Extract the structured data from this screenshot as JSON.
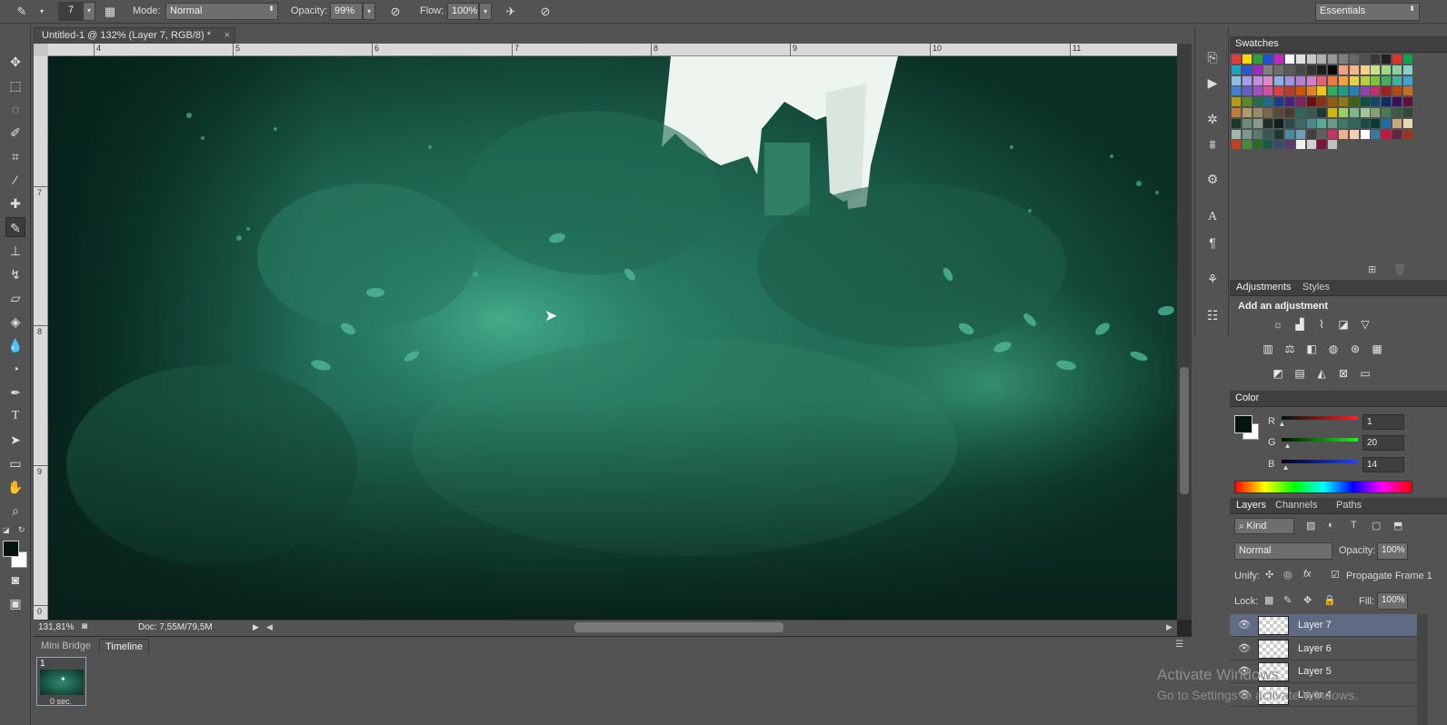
{
  "options_bar": {
    "brush_size": "7",
    "mode_label": "Mode:",
    "mode_value": "Normal",
    "opacity_label": "Opacity:",
    "opacity_value": "99%",
    "flow_label": "Flow:",
    "flow_value": "100%",
    "workspace": "Essentials"
  },
  "document": {
    "tab_title": "Untitled-1 @ 132% (Layer 7, RGB/8) *",
    "ruler_h": [
      "4",
      "5",
      "6",
      "7",
      "8",
      "9",
      "10",
      "11"
    ],
    "ruler_v": [
      "7",
      "8",
      "9",
      "0"
    ],
    "zoom": "131,81%",
    "doc_size": "Doc: 7,55M/79,5M"
  },
  "timeline": {
    "tabs": [
      "Mini Bridge",
      "Timeline"
    ],
    "frame_number": "1",
    "frame_delay": "0 sec."
  },
  "swatches": {
    "title": "Swatches",
    "colors": [
      "#e53935",
      "#f5d90a",
      "#2e9e3a",
      "#1e4fd6",
      "#c128c1",
      "#ffffff",
      "#e0e0e0",
      "#c8c8c8",
      "#b0b0b0",
      "#989898",
      "#808080",
      "#686868",
      "#505050",
      "#383838",
      "#202020",
      "#e0332d",
      "#12a352",
      "#1aa3c7",
      "#2b57c9",
      "#9c2bbf",
      "#808080",
      "#6e6e6e",
      "#5a5a5a",
      "#474747",
      "#333333",
      "#1e1e1e",
      "#0a0a0a",
      "#f0a08a",
      "#f6b48a",
      "#f8d08a",
      "#c8e08a",
      "#9cd88a",
      "#8ad0a0",
      "#8ad0c8",
      "#8ac0e8",
      "#a0a0e8",
      "#c090e0",
      "#e08ac8",
      "#8ab0e8",
      "#a090e0",
      "#b080d8",
      "#d080c8",
      "#e0607a",
      "#f07a40",
      "#f4a040",
      "#e8d040",
      "#b8d040",
      "#80c040",
      "#40b060",
      "#40b0a0",
      "#40a0d0",
      "#4080d0",
      "#6060c8",
      "#a050c0",
      "#d050a0",
      "#e04040",
      "#c0392b",
      "#d35400",
      "#e67e22",
      "#f1c40f",
      "#27ae60",
      "#16a085",
      "#2980b9",
      "#8e44ad",
      "#c0306a",
      "#a32020",
      "#b84818",
      "#c07020",
      "#b89a10",
      "#5a8a20",
      "#207050",
      "#206a8a",
      "#203a8a",
      "#4a2080",
      "#802060",
      "#6a1010",
      "#8a3010",
      "#9a5a10",
      "#8a7a10",
      "#406010",
      "#105040",
      "#104a6a",
      "#102a6a",
      "#3a1060",
      "#601040",
      "#c07d3a",
      "#b39a6a",
      "#9a8a6a",
      "#7a6a4a",
      "#5a4a3a",
      "#4a3a2a",
      "#2a6a5a",
      "#3a5a4a",
      "#1a3a3a",
      "#d4b800",
      "#9bd060",
      "#7ab890",
      "#a0c8a0",
      "#80a070",
      "#4a7a5a",
      "#3a5a4a",
      "#2a4a3a",
      "#1a3a2a",
      "#6a8a7a",
      "#8a9a8a",
      "#1f2f2a",
      "#0f1f1a",
      "#2a4a4a",
      "#3a6a6a",
      "#4a8a8a",
      "#5aaa9a",
      "#6a9a8a",
      "#3a7a6a",
      "#2a6a5a",
      "#1a4a4a",
      "#0a3a3a",
      "#1d6fa5",
      "#c9a97a",
      "#e8d8b0",
      "#a0b8b0",
      "#7a9a90",
      "#5a7a70",
      "#3a5a50",
      "#1a3a30",
      "#4a8aa0",
      "#6aa0b8",
      "#404040",
      "#606060",
      "#d03060",
      "#f0b090",
      "#f0d0b0",
      "#ffffff",
      "#3a7aa0",
      "#d01040",
      "#6a2040",
      "#a03020",
      "#c04020",
      "#4a8a40",
      "#2a6a2a",
      "#1a5a4a",
      "#3a4a6a",
      "#5a3a6a",
      "#f0f0f0",
      "#d0d0d0",
      "#801040",
      "#c0c0c0"
    ]
  },
  "adjustments": {
    "tabs": [
      "Adjustments",
      "Styles"
    ],
    "heading": "Add an adjustment",
    "row1": [
      "brightness-contrast-icon",
      "levels-icon",
      "curves-icon",
      "exposure-icon",
      "vibrance-icon"
    ],
    "row2": [
      "hue-saturation-icon",
      "color-balance-icon",
      "black-white-icon",
      "photo-filter-icon",
      "channel-mixer-icon",
      "color-lookup-icon"
    ],
    "row3": [
      "invert-icon",
      "posterize-icon",
      "threshold-icon",
      "selective-color-icon",
      "gradient-map-icon"
    ]
  },
  "color": {
    "title": "Color",
    "fg": "#01140e",
    "r_label": "R",
    "g_label": "G",
    "b_label": "B",
    "r": 1,
    "g": 20,
    "b": 14
  },
  "layers": {
    "tabs": [
      "Layers",
      "Channels",
      "Paths"
    ],
    "filter": "Kind",
    "blend": "Normal",
    "opacity_label": "Opacity:",
    "opacity": "100%",
    "unify_label": "Unify:",
    "propagate": "Propagate Frame 1",
    "lock_label": "Lock:",
    "fill_label": "Fill:",
    "fill": "100%",
    "items": [
      "Layer 7",
      "Layer 6",
      "Layer 5",
      "Layer 4"
    ]
  },
  "windows_watermark": {
    "line1": "Activate Windows",
    "line2": "Go to Settings to activate Windows."
  }
}
